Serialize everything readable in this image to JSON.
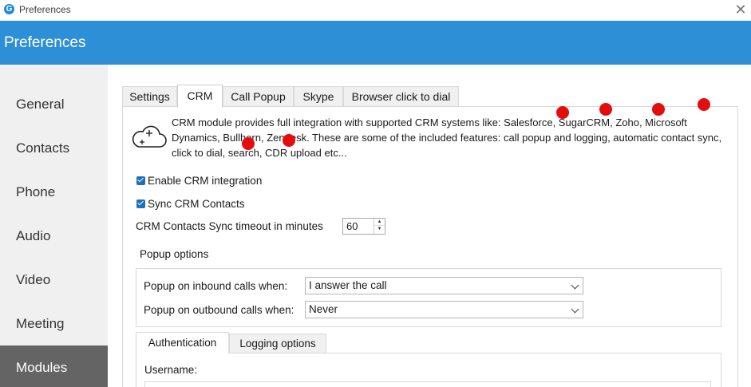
{
  "window": {
    "title": "Preferences",
    "app_icon_letter": "G"
  },
  "header": {
    "title": "Preferences"
  },
  "sidebar": {
    "items": [
      {
        "label": "General"
      },
      {
        "label": "Contacts"
      },
      {
        "label": "Phone"
      },
      {
        "label": "Audio"
      },
      {
        "label": "Video"
      },
      {
        "label": "Meeting"
      },
      {
        "label": "Modules"
      }
    ],
    "active": "Modules"
  },
  "tabs": [
    {
      "label": "Settings"
    },
    {
      "label": "CRM"
    },
    {
      "label": "Call Popup"
    },
    {
      "label": "Skype"
    },
    {
      "label": "Browser click to dial"
    }
  ],
  "active_tab": "CRM",
  "crm": {
    "description": "CRM module provides full integration with supported CRM systems like: Salesforce, SugarCRM, Zoho, Microsoft Dynamics, Bullhorn, Zendesk. These are some of the included features: call popup and logging, automatic contact sync, click to dial, search, CDR upload etc...",
    "enable_label": "Enable CRM integration",
    "enable_checked": true,
    "sync_label": "Sync CRM Contacts",
    "sync_checked": true,
    "timeout_label": "CRM Contacts Sync timeout in minutes",
    "timeout_value": "60",
    "popup_options": {
      "title": "Popup options",
      "inbound_label": "Popup on inbound calls when:",
      "inbound_value": "I answer the call",
      "outbound_label": "Popup on outbound calls when:",
      "outbound_value": "Never"
    },
    "subtabs": [
      {
        "label": "Authentication"
      },
      {
        "label": "Logging options"
      }
    ],
    "active_subtab": "Authentication",
    "username_label": "Username:"
  },
  "colors": {
    "header_bg": "#2d8fd5",
    "sidebar_active_bg": "#646464",
    "checkbox": "#1e6fc0",
    "marker_dot": "#e30d0d"
  }
}
